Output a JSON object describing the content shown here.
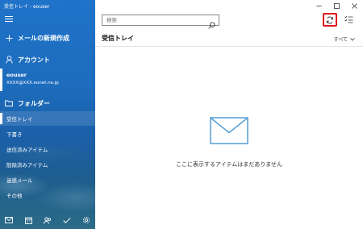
{
  "window": {
    "title": "受信トレイ - eouser"
  },
  "sidebar": {
    "new_mail_label": "メールの新規作成",
    "account_header": "アカウント",
    "account": {
      "name": "eouser",
      "email": "XXXX@XXX.eonet.ne.jp"
    },
    "folders_header": "フォルダー",
    "folders": [
      {
        "label": "受信トレイ",
        "active": true
      },
      {
        "label": "下書き"
      },
      {
        "label": "送信済みアイテム"
      },
      {
        "label": "削除済みアイテム"
      },
      {
        "label": "迷惑メール"
      },
      {
        "label": "その他"
      }
    ],
    "bottom_icons": [
      "mail-icon",
      "calendar-icon",
      "people-icon",
      "todo-icon",
      "settings-icon"
    ]
  },
  "main": {
    "search_placeholder": "検索",
    "folder_title": "受信トレイ",
    "filter_label": "すべて",
    "empty_message": "ここに表示するアイテムはまだありません"
  },
  "colors": {
    "sidebar_blue": "#1f73c9",
    "highlight_red": "#e3141b",
    "envelope_blue": "#5ba2d6"
  }
}
